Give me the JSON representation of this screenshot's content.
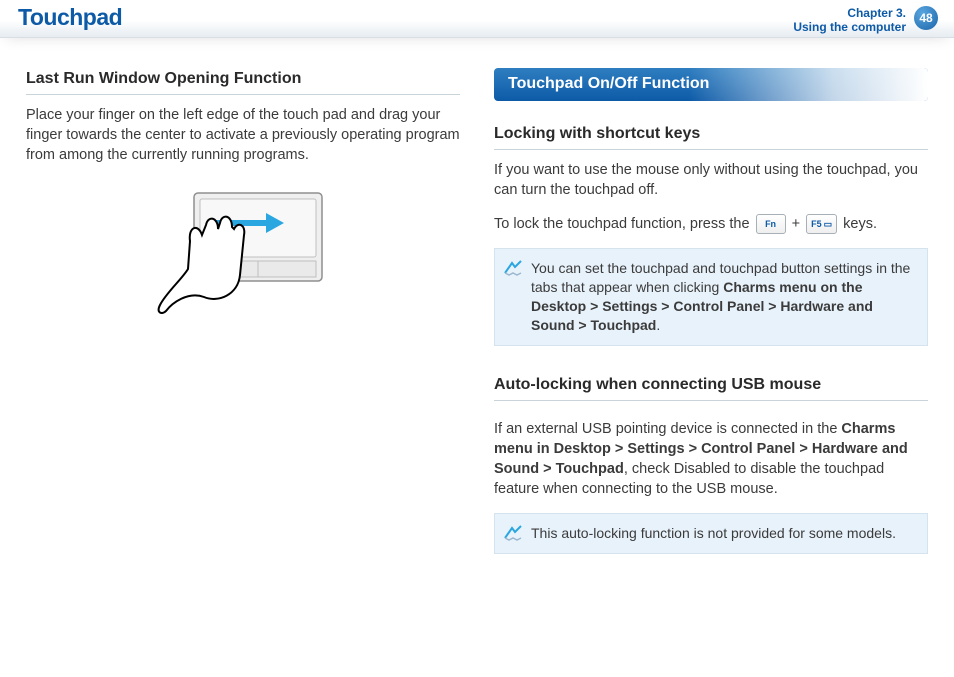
{
  "header": {
    "title": "Touchpad",
    "chapter_line1": "Chapter 3.",
    "chapter_line2": "Using the computer",
    "page_number": "48"
  },
  "left": {
    "heading": "Last Run Window Opening Function",
    "body": "Place your finger on the left edge of the touch pad and drag your finger towards the center to activate a previously operating program from among the currently running programs."
  },
  "right": {
    "section_bar": "Touchpad On/Off Function",
    "sub1_heading": "Locking with shortcut keys",
    "sub1_para1": "If you want to use the mouse only without using the touchpad, you can turn the touchpad off.",
    "sub1_para2_pre": "To lock the touchpad function, press the ",
    "sub1_para2_post": " keys.",
    "key_fn": "Fn",
    "key_plus": "+",
    "key_f5": "F5",
    "note1_pre": "You can set the touchpad and touchpad button settings in the tabs that appear when clicking ",
    "note1_bold": "Charms menu on the Desktop > Settings > Control Panel > Hardware and Sound > Touchpad",
    "note1_post": ".",
    "sub2_heading": "Auto-locking when connecting USB mouse",
    "sub2_para_pre": "If an external USB pointing device is connected in the ",
    "sub2_para_bold": "Charms menu in Desktop > Settings > Control Panel > Hardware and Sound > Touchpad",
    "sub2_para_post": ", check Disabled to disable the touchpad feature when connecting to the USB mouse.",
    "note2": "This auto-locking function is not provided for some models."
  }
}
